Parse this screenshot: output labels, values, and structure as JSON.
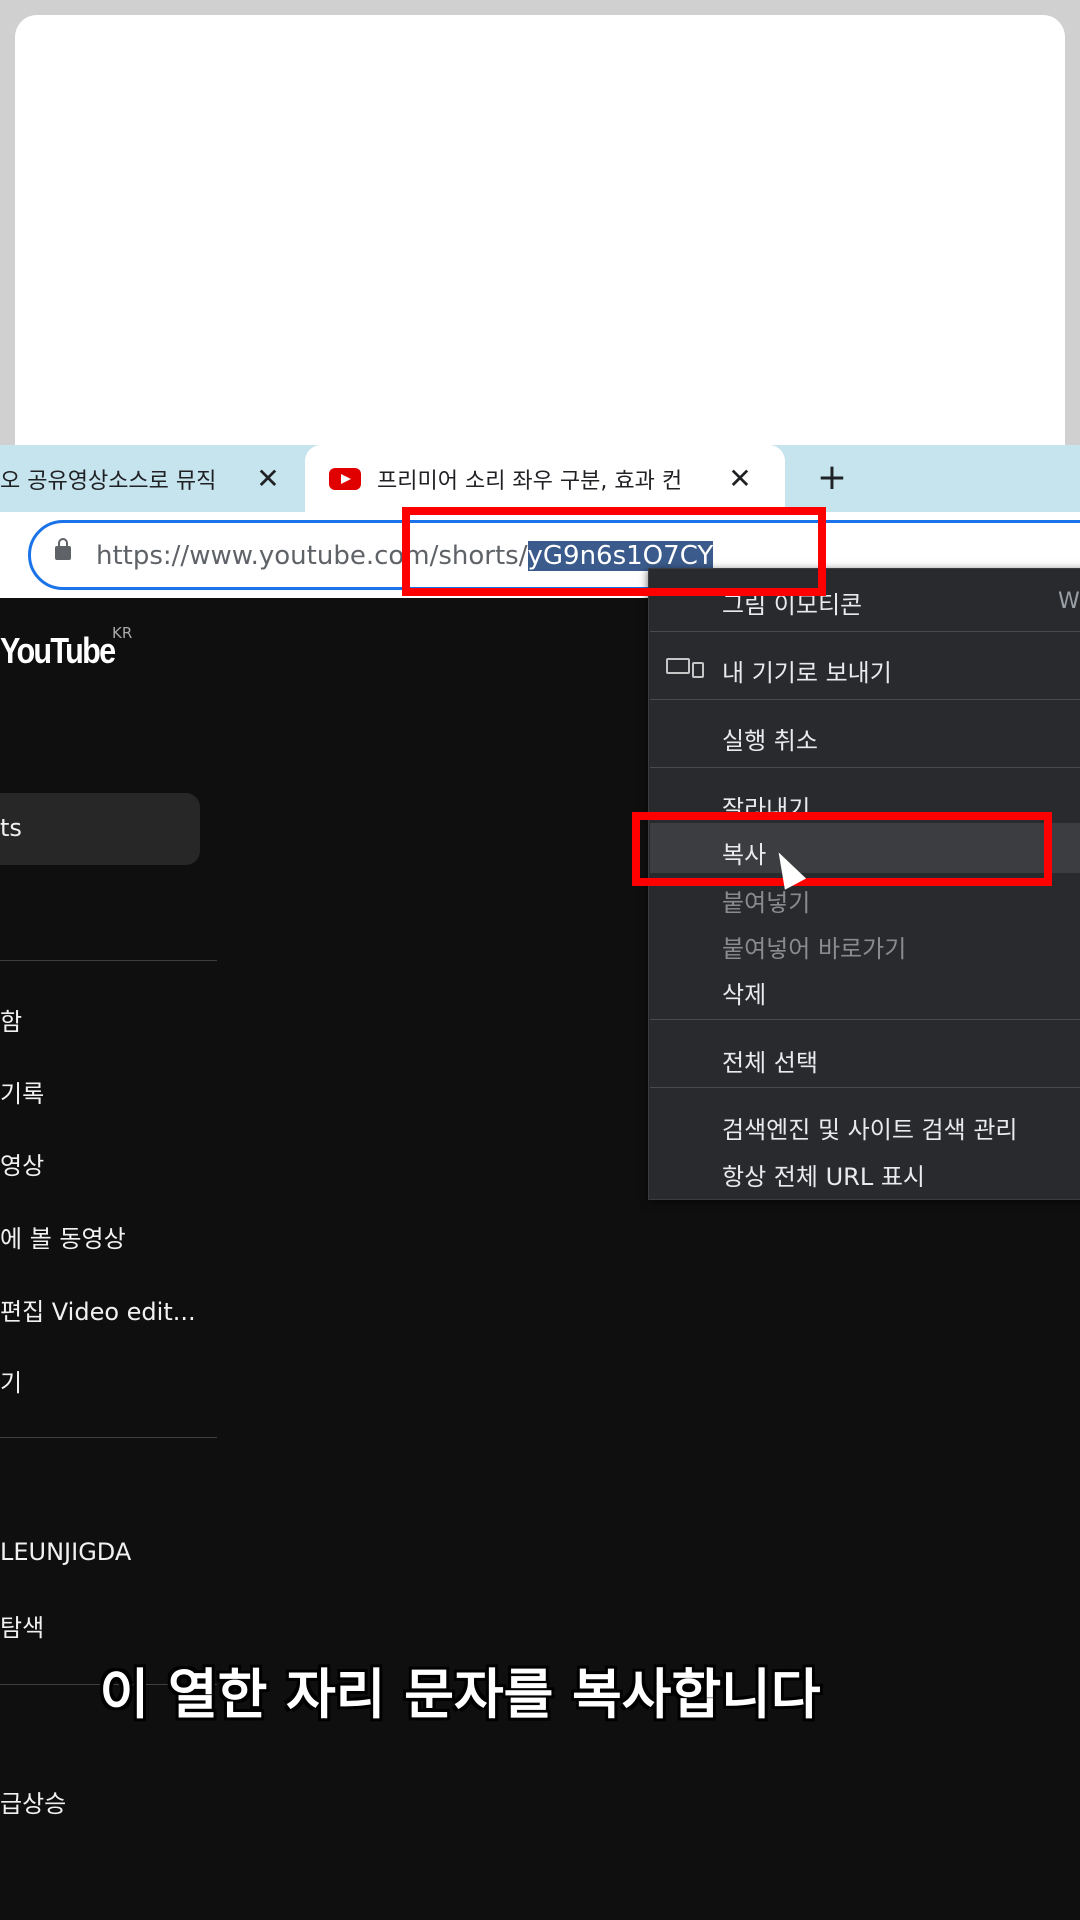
{
  "browser": {
    "tabs": [
      {
        "title": "오 공유영상소스로 뮤직",
        "active": false
      },
      {
        "title": "프리미어 소리 좌우 구분, 효과 컨",
        "active": true
      }
    ],
    "tab_close_glyph": "✕",
    "new_tab_glyph": "+",
    "url_prefix": "https://www.youtube.com/shorts/",
    "url_selected": "yG9n6s1O7CY"
  },
  "youtube": {
    "logo": "YouTube",
    "region": "KR",
    "sidebar_items": [
      {
        "label": "ts",
        "active": true
      },
      {
        "label": "함"
      },
      {
        "label": "기록"
      },
      {
        "label": "영상"
      },
      {
        "label": "에 볼 동영상"
      },
      {
        "label": "편집 Video edit..."
      },
      {
        "label": "기"
      },
      {
        "label": "LEUNJIGDA"
      },
      {
        "label": "탐색"
      },
      {
        "label": "급상승"
      }
    ]
  },
  "context_menu": {
    "items": [
      {
        "label": "그림 이모티콘",
        "shortcut": "W"
      },
      {
        "label": "내 기기로 보내기",
        "icon": "device-icon"
      },
      {
        "label": "실행 취소"
      },
      {
        "label": "잘라내기"
      },
      {
        "label": "복사",
        "highlighted": true
      },
      {
        "label": "붙여넣기",
        "disabled": true
      },
      {
        "label": "붙여넣어 바로가기",
        "disabled": true
      },
      {
        "label": "삭제"
      },
      {
        "label": "전체 선택"
      },
      {
        "label": "검색엔진 및 사이트 검색 관리"
      },
      {
        "label": "항상 전체 URL 표시"
      }
    ]
  },
  "caption": "이 열한 자리 문자를 복사합니다",
  "colors": {
    "tabstrip": "#c5e4ee",
    "omnibox_border": "#1a73e8",
    "yt_bg": "#0f0f0f",
    "menu_bg": "#292a2d",
    "highlight_red": "#ff0000"
  }
}
